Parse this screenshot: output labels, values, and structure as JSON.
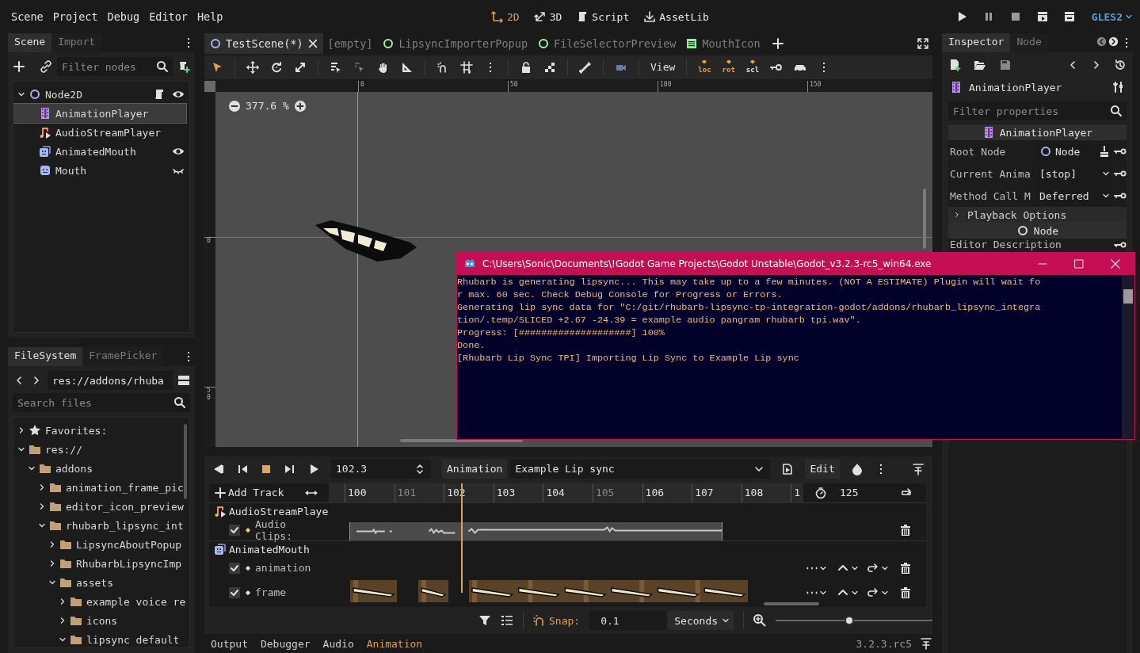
{
  "menu": [
    "Scene",
    "Project",
    "Debug",
    "Editor",
    "Help"
  ],
  "workspaces": [
    {
      "label": "2D",
      "selected": true
    },
    {
      "label": "3D",
      "selected": false
    },
    {
      "label": "Script",
      "selected": false
    },
    {
      "label": "AssetLib",
      "selected": false
    }
  ],
  "renderer": "GLES2",
  "scene_dock": {
    "tabs": [
      {
        "label": "Scene",
        "selected": true
      },
      {
        "label": "Import",
        "selected": false
      }
    ],
    "filter_placeholder": "Filter nodes",
    "tree": [
      {
        "label": "Node2D",
        "kind": "node2d",
        "expanded": true,
        "selected": false,
        "has_script": true,
        "visible": true,
        "children": [
          {
            "label": "AnimationPlayer",
            "kind": "animation",
            "selected": true
          },
          {
            "label": "AudioStreamPlayer",
            "kind": "audio",
            "selected": false
          },
          {
            "label": "AnimatedMouth",
            "kind": "animated_sprite",
            "selected": false,
            "visible": true
          },
          {
            "label": "Mouth",
            "kind": "sprite",
            "selected": false,
            "visible": false
          }
        ]
      }
    ]
  },
  "filesystem": {
    "tabs": [
      {
        "label": "FileSystem",
        "selected": true
      },
      {
        "label": "FramePicker",
        "selected": false
      }
    ],
    "path": "res://addons/rhuba",
    "search_placeholder": "Search files",
    "tree": [
      {
        "label": "Favorites:",
        "kind": "favorites",
        "expanded": false
      },
      {
        "label": "res://",
        "kind": "folder",
        "expanded": true,
        "children": [
          {
            "label": "addons",
            "kind": "folder",
            "expanded": true,
            "children": [
              {
                "label": "animation_frame_pic",
                "kind": "folder",
                "expanded": false
              },
              {
                "label": "editor_icon_preview",
                "kind": "folder",
                "expanded": false
              },
              {
                "label": "rhubarb_lipsync_int",
                "kind": "folder",
                "expanded": true,
                "children": [
                  {
                    "label": "LipsyncAboutPopup",
                    "kind": "folder",
                    "expanded": false
                  },
                  {
                    "label": "RhubarbLipsyncImp",
                    "kind": "folder",
                    "expanded": false
                  },
                  {
                    "label": "assets",
                    "kind": "folder",
                    "expanded": true,
                    "children": [
                      {
                        "label": "example voice re",
                        "kind": "folder",
                        "expanded": false
                      },
                      {
                        "label": "icons",
                        "kind": "folder",
                        "expanded": false
                      },
                      {
                        "label": "lipsync default",
                        "kind": "folder",
                        "expanded": true
                      }
                    ]
                  }
                ]
              }
            ]
          }
        ]
      }
    ]
  },
  "editor_tabs": [
    {
      "label": "TestScene(*)",
      "kind": "node2d",
      "selected": true
    },
    {
      "label": "[empty]",
      "kind": "none",
      "selected": false
    },
    {
      "label": "LipsyncImporterPopup",
      "kind": "control",
      "selected": false
    },
    {
      "label": "FileSelectorPreview",
      "kind": "control",
      "selected": false
    },
    {
      "label": "MouthIcon",
      "kind": "script",
      "selected": false
    }
  ],
  "toolbar": {
    "view_menu": "View",
    "key_buttons": [
      "loc",
      "rot",
      "scl"
    ]
  },
  "viewport": {
    "zoom": "377.6 %",
    "hticks": [
      "0",
      "50",
      "100",
      "150"
    ],
    "vticks": [
      "0",
      "50"
    ]
  },
  "animation": {
    "time": "102.3",
    "animation_button": "Animation",
    "current": "Example Lip sync",
    "edit_button": "Edit",
    "add_track": "Add Track",
    "ticks": [
      {
        "label": "100",
        "dim": false
      },
      {
        "label": "101",
        "dim": true
      },
      {
        "label": "102",
        "dim": false
      },
      {
        "label": "103",
        "dim": false
      },
      {
        "label": "104",
        "dim": false
      },
      {
        "label": "105",
        "dim": true
      },
      {
        "label": "106",
        "dim": false
      },
      {
        "label": "107",
        "dim": false
      },
      {
        "label": "108",
        "dim": false
      },
      {
        "label": "1",
        "dim": false
      }
    ],
    "length": "125",
    "groups": [
      {
        "node": "AudioStreamPlaye",
        "kind": "audio",
        "tracks": [
          {
            "label": "Audio Clips:",
            "kind": "audio",
            "enabled": true
          }
        ]
      },
      {
        "node": "AnimatedMouth",
        "kind": "animated_sprite",
        "tracks": [
          {
            "label": "animation",
            "kind": "empty",
            "enabled": true
          },
          {
            "label": "frame",
            "kind": "frames",
            "enabled": true
          }
        ]
      }
    ],
    "snap_label": "Snap:",
    "snap": "0.1",
    "snap_unit": "Seconds",
    "zoom": {
      "level": 0.47
    }
  },
  "bottom_tabs": [
    {
      "label": "Output",
      "selected": false
    },
    {
      "label": "Debugger",
      "selected": false
    },
    {
      "label": "Audio",
      "selected": false
    },
    {
      "label": "Animation",
      "selected": true
    }
  ],
  "version": "3.2.3.rc5",
  "inspector": {
    "tabs": [
      {
        "label": "Inspector",
        "selected": true
      },
      {
        "label": "Node",
        "selected": false
      }
    ],
    "object": "AnimationPlayer",
    "filter_placeholder": "Filter properties",
    "items": [
      {
        "kind": "class_header",
        "label": "AnimationPlayer"
      },
      {
        "kind": "node_path_property",
        "label": "Root Node",
        "value": "Node"
      },
      {
        "kind": "enum_property",
        "label": "Current Anima",
        "value": "[stop]"
      },
      {
        "kind": "enum_property",
        "label": "Method Call M",
        "value": "Deferred"
      },
      {
        "kind": "group",
        "label": "Playback Options",
        "expanded": false
      },
      {
        "kind": "node_header",
        "label": "Node"
      },
      {
        "kind": "text_property",
        "label": "Editor Description"
      }
    ]
  },
  "console": {
    "title": "C:\\Users\\Sonic\\Documents\\!Godot Game Projects\\Godot Unstable\\Godot_v3.2.3-rc5_win64.exe",
    "lines": [
      "Rhubarb is generating lipsync... This may take up to a few minutes. (NOT A ESTIMATE) Plugin will wait fo",
      "r max. 60 sec. Check Debug Console for Progress or Errors.",
      "Generating lip sync data for \"C:/git/rhubarb-lipsync-tp-integration-godot/addons/rhubarb_lipsync_integra",
      "tion/.temp/SLICED +2.67 -24.39 = example audio pangram rhubarb tpi.wav\".",
      "Progress: [####################] 100%",
      "Done.",
      "[Rhubarb Lip Sync TPI] Importing Lip Sync to Example Lip sync"
    ]
  }
}
